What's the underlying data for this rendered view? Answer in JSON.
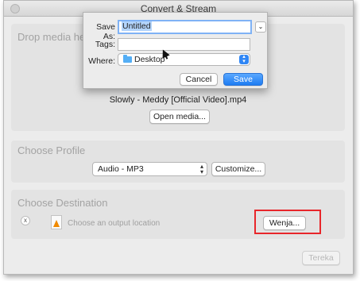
{
  "window": {
    "title": "Convert & Stream"
  },
  "source": {
    "heading": "Drop media here",
    "filename": "Slowly - Meddy [Official Video].mp4",
    "open_media_label": "Open media..."
  },
  "profile": {
    "heading": "Choose Profile",
    "selected": "Audio - MP3",
    "customize_label": "Customize..."
  },
  "destination": {
    "heading": "Choose Destination",
    "remove_label": "x",
    "placeholder": "Choose an output location",
    "browse_label": "Wenja..."
  },
  "footer": {
    "go_label": "Tereka"
  },
  "save_sheet": {
    "save_as_label": "Save As:",
    "save_as_value": "Untitled",
    "tags_label": "Tags:",
    "tags_value": "",
    "where_label": "Where:",
    "where_value": "Desktop",
    "cancel_label": "Cancel",
    "save_label": "Save",
    "expand_glyph": "⌄"
  },
  "colors": {
    "accent": "#1e7cf2",
    "highlight_box": "#e8262a",
    "vlc_cone": "#f08a00"
  },
  "icons": [
    "close-icon",
    "chevron-down-icon",
    "folder-icon",
    "updown-arrows-icon",
    "vlc-cone-icon",
    "pointer-cursor-icon"
  ]
}
